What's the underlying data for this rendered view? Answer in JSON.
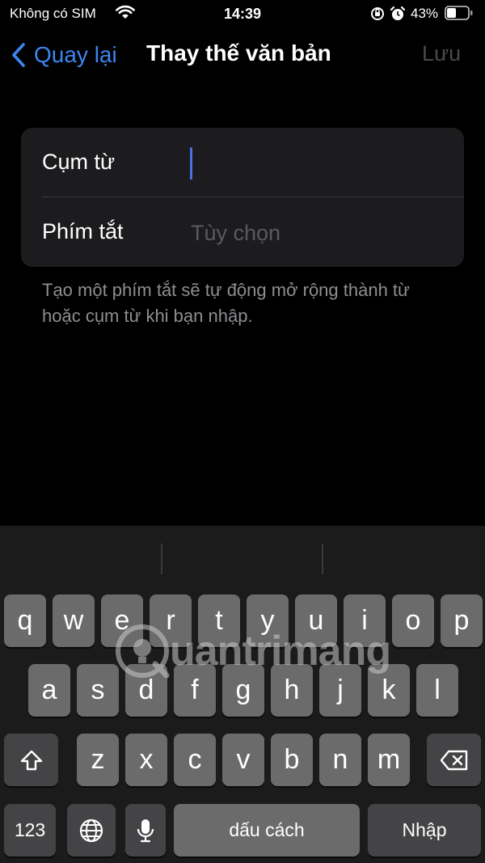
{
  "status": {
    "carrier": "Không có SIM",
    "time": "14:39",
    "battery": "43%",
    "battery_level": 0.43
  },
  "nav": {
    "back_label": "Quay lại",
    "title": "Thay thế văn bản",
    "save_label": "Lưu"
  },
  "form": {
    "phrase_label": "Cụm từ",
    "phrase_value": "",
    "shortcut_label": "Phím tắt",
    "shortcut_placeholder": "Tùy chọn"
  },
  "footer_note": "Tạo một phím tắt sẽ tự động mở rộng thành từ hoặc cụm từ khi bạn nhập.",
  "keyboard": {
    "row1": [
      "q",
      "w",
      "e",
      "r",
      "t",
      "y",
      "u",
      "i",
      "o",
      "p"
    ],
    "row2": [
      "a",
      "s",
      "d",
      "f",
      "g",
      "h",
      "j",
      "k",
      "l"
    ],
    "row3": [
      "z",
      "x",
      "c",
      "v",
      "b",
      "n",
      "m"
    ],
    "numbers_label": "123",
    "space_label": "dấu cách",
    "return_label": "Nhập",
    "icons": {
      "shift": "shift-icon",
      "delete": "delete-icon",
      "globe": "globe-icon",
      "mic": "microphone-icon"
    }
  },
  "watermark": "uantrimang"
}
